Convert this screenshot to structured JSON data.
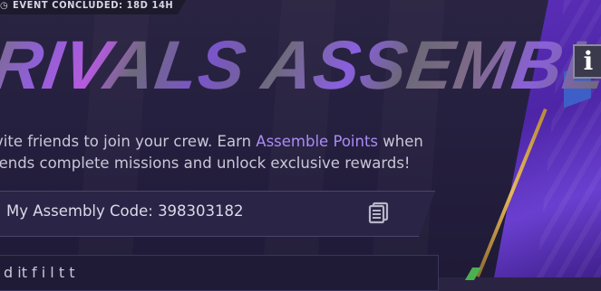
{
  "event_banner": {
    "icon": "clock-icon",
    "text": "EVENT CONCLUDED: 18D 14H"
  },
  "title": "RIVALS ASSEMBLE!",
  "info_button": {
    "label": "i",
    "icon": "info-icon"
  },
  "description": {
    "part1": "vite friends to join your crew. Earn ",
    "highlight": "Assemble Points",
    "part2": " when",
    "line2": "iends complete missions and unlock exclusive rewards!"
  },
  "assembly_code": {
    "label": "My Assembly Code: 398303182",
    "copy_icon": "copy-icon"
  },
  "bottom_text": "d it f i l t t ",
  "colors": {
    "background": "#262040",
    "accent_purple": "#a98cf5",
    "panel_purple": "#5b2fb8",
    "gold": "#e6b85a"
  }
}
